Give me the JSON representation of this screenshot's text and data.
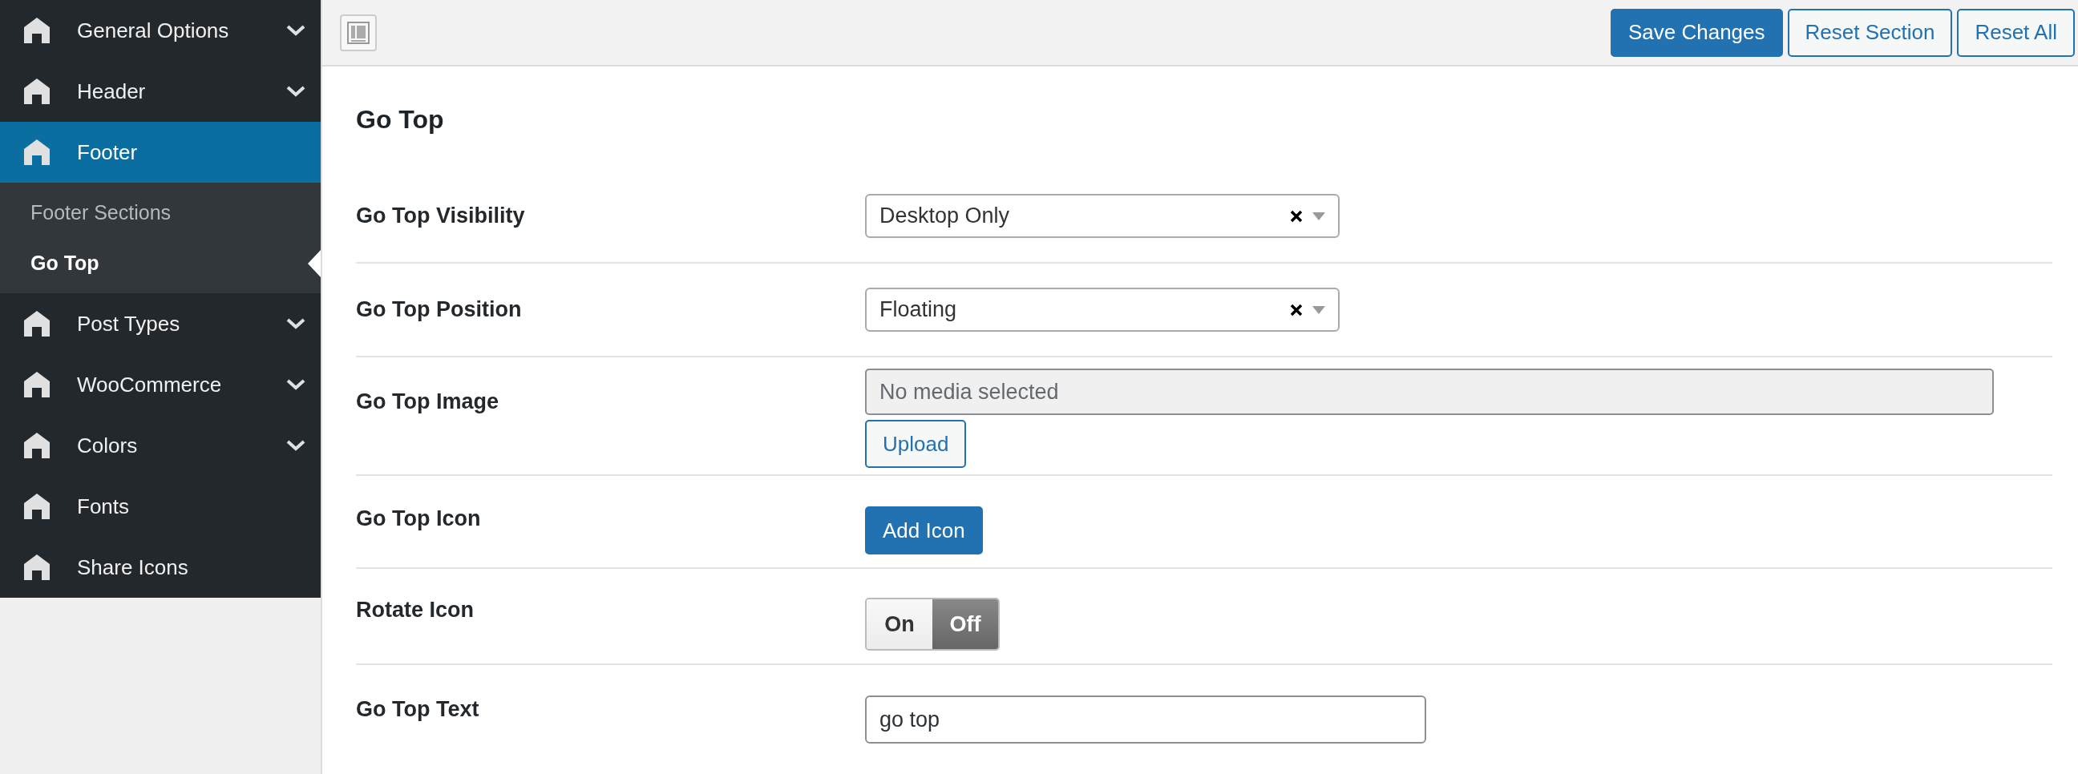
{
  "sidebar": {
    "items": [
      {
        "label": "General Options",
        "expandable": true,
        "selected": false
      },
      {
        "label": "Header",
        "expandable": true,
        "selected": false
      },
      {
        "label": "Footer",
        "expandable": false,
        "selected": true,
        "children": [
          {
            "label": "Footer Sections",
            "selected": false
          },
          {
            "label": "Go Top",
            "selected": true
          }
        ]
      },
      {
        "label": "Post Types",
        "expandable": true,
        "selected": false
      },
      {
        "label": "WooCommerce",
        "expandable": true,
        "selected": false
      },
      {
        "label": "Colors",
        "expandable": true,
        "selected": false
      },
      {
        "label": "Fonts",
        "expandable": false,
        "selected": false
      },
      {
        "label": "Share Icons",
        "expandable": false,
        "selected": false
      }
    ]
  },
  "toolbar": {
    "buttons": [
      {
        "label": "Save Changes",
        "kind": "primary"
      },
      {
        "label": "Reset Section",
        "kind": "secondary"
      },
      {
        "label": "Reset All",
        "kind": "secondary"
      }
    ]
  },
  "section": {
    "title": "Go Top",
    "fields": [
      {
        "label": "Go Top Visibility",
        "kind": "select",
        "value": "Desktop Only"
      },
      {
        "label": "Go Top Position",
        "kind": "select",
        "value": "Floating"
      },
      {
        "label": "Go Top Image",
        "kind": "media",
        "placeholder": "No media selected",
        "button": "Upload"
      },
      {
        "label": "Go Top Icon",
        "kind": "button",
        "button": "Add Icon"
      },
      {
        "label": "Rotate Icon",
        "kind": "toggle",
        "options": [
          {
            "label": "On",
            "selected": false
          },
          {
            "label": "Off",
            "selected": true
          }
        ]
      },
      {
        "label": "Go Top Text",
        "kind": "text",
        "value": "go top"
      }
    ]
  }
}
